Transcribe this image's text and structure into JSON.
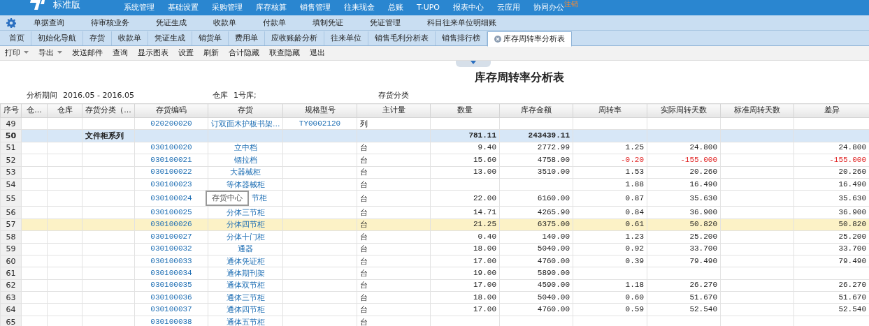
{
  "app": {
    "edition": "标准版",
    "menu": [
      "系统管理",
      "基础设置",
      "采购管理",
      "库存核算",
      "销售管理",
      "往来现金",
      "总账",
      "T-UPO",
      "报表中心",
      "云应用",
      "协同办公"
    ],
    "logout": "注销"
  },
  "quickbar": [
    "单据查询",
    "待审核业务",
    "凭证生成",
    "收款单",
    "付款单",
    "填制凭证",
    "凭证管理",
    "科目往来单位明细账"
  ],
  "tabs": [
    {
      "label": "首页",
      "selected": false
    },
    {
      "label": "初始化导航",
      "selected": false
    },
    {
      "label": "存货",
      "selected": false
    },
    {
      "label": "收款单",
      "selected": false
    },
    {
      "label": "凭证生成",
      "selected": false
    },
    {
      "label": "销货单",
      "selected": false
    },
    {
      "label": "费用单",
      "selected": false
    },
    {
      "label": "应收账龄分析",
      "selected": false
    },
    {
      "label": "往来单位",
      "selected": false
    },
    {
      "label": "销售毛利分析表",
      "selected": false
    },
    {
      "label": "销售排行榜",
      "selected": false
    },
    {
      "label": "库存周转率分析表",
      "selected": true
    }
  ],
  "toolbar": [
    {
      "label": "打印",
      "dropdown": true
    },
    {
      "label": "导出",
      "dropdown": true
    },
    {
      "label": "发送邮件",
      "dropdown": false
    },
    {
      "label": "查询",
      "dropdown": false
    },
    {
      "label": "显示图表",
      "dropdown": false
    },
    {
      "label": "设置",
      "dropdown": false
    },
    {
      "label": "刷新",
      "dropdown": false
    },
    {
      "label": "合计隐藏",
      "dropdown": false
    },
    {
      "label": "联查隐藏",
      "dropdown": false
    },
    {
      "label": "退出",
      "dropdown": false
    }
  ],
  "report": {
    "title": "库存周转率分析表",
    "filters": [
      {
        "label": "分析期间",
        "value": "2016.05 - 2016.05"
      },
      {
        "label": "仓库",
        "value": "1号库;"
      },
      {
        "label": "存货分类"
      }
    ]
  },
  "table": {
    "columns": [
      "序号",
      "仓...",
      "仓库",
      "存货分类（...",
      "存货编码",
      "存货",
      "规格型号",
      "主计量",
      "数量",
      "库存金额",
      "周转率",
      "实际周转天数",
      "标准周转天数",
      "差异"
    ],
    "rows": [
      {
        "kind": "item",
        "selected": false,
        "no": "49",
        "code": "020200020",
        "item": "订双面木护板书架...",
        "spec": "TY0002120",
        "unit": "列"
      },
      {
        "kind": "group",
        "selected": false,
        "no": "50",
        "category": "文件柜系列",
        "qty": "781.11",
        "amount": "243439.11"
      },
      {
        "kind": "item",
        "selected": false,
        "no": "51",
        "code": "030100020",
        "item": "立中档",
        "unit": "台",
        "qty": "9.40",
        "amount": "2772.99",
        "turnover": "1.25",
        "actual_days": "24.800",
        "diff": "24.800"
      },
      {
        "kind": "item",
        "selected": false,
        "negative": true,
        "no": "52",
        "code": "030100021",
        "item": "锢拉档",
        "unit": "台",
        "qty": "15.60",
        "amount": "4758.00",
        "turnover": "-0.20",
        "actual_days": "-155.000",
        "diff": "-155.000"
      },
      {
        "kind": "item",
        "selected": false,
        "no": "53",
        "code": "030100022",
        "item": "大器械柜",
        "unit": "台",
        "qty": "13.00",
        "amount": "3510.00",
        "turnover": "1.53",
        "actual_days": "20.260",
        "diff": "20.260"
      },
      {
        "kind": "item",
        "selected": false,
        "no": "54",
        "code": "030100023",
        "item": "等体器械柜",
        "unit": "台",
        "turnover": "1.88",
        "actual_days": "16.490",
        "diff": "16.490"
      },
      {
        "kind": "item",
        "selected": false,
        "no": "55",
        "code": "030100024",
        "item": "节柜",
        "unit": "台",
        "qty": "22.00",
        "amount": "6160.00",
        "turnover": "0.87",
        "actual_days": "35.630",
        "diff": "35.630",
        "tooltip": "存货中心"
      },
      {
        "kind": "item",
        "selected": false,
        "no": "56",
        "code": "030100025",
        "item": "分体三节柜",
        "unit": "台",
        "qty": "14.71",
        "amount": "4265.90",
        "turnover": "0.84",
        "actual_days": "36.900",
        "diff": "36.900"
      },
      {
        "kind": "item",
        "selected": true,
        "no": "57",
        "code": "030100026",
        "item": "分体四节柜",
        "unit": "台",
        "qty": "21.25",
        "amount": "6375.00",
        "turnover": "0.61",
        "actual_days": "50.820",
        "diff": "50.820"
      },
      {
        "kind": "item",
        "selected": false,
        "no": "58",
        "code": "030100027",
        "item": "分体十门柜",
        "unit": "台",
        "qty": "0.40",
        "amount": "140.00",
        "turnover": "1.23",
        "actual_days": "25.200",
        "diff": "25.200"
      },
      {
        "kind": "item",
        "selected": false,
        "no": "59",
        "code": "030100032",
        "item": "通器",
        "unit": "台",
        "qty": "18.00",
        "amount": "5040.00",
        "turnover": "0.92",
        "actual_days": "33.700",
        "diff": "33.700"
      },
      {
        "kind": "item",
        "selected": false,
        "no": "60",
        "code": "030100033",
        "item": "通体凭证柜",
        "unit": "台",
        "qty": "17.00",
        "amount": "4760.00",
        "turnover": "0.39",
        "actual_days": "79.490",
        "diff": "79.490"
      },
      {
        "kind": "item",
        "selected": false,
        "no": "61",
        "code": "030100034",
        "item": "通体期刊架",
        "unit": "台",
        "qty": "19.00",
        "amount": "5890.00"
      },
      {
        "kind": "item",
        "selected": false,
        "no": "62",
        "code": "030100035",
        "item": "通体双节柜",
        "unit": "台",
        "qty": "17.00",
        "amount": "4590.00",
        "turnover": "1.18",
        "actual_days": "26.270",
        "diff": "26.270"
      },
      {
        "kind": "item",
        "selected": false,
        "no": "63",
        "code": "030100036",
        "item": "通体三节柜",
        "unit": "台",
        "qty": "18.00",
        "amount": "5040.00",
        "turnover": "0.60",
        "actual_days": "51.670",
        "diff": "51.670"
      },
      {
        "kind": "item",
        "selected": false,
        "no": "64",
        "code": "030100037",
        "item": "通体四节柜",
        "unit": "台",
        "qty": "17.00",
        "amount": "4760.00",
        "turnover": "0.59",
        "actual_days": "52.540",
        "diff": "52.540"
      },
      {
        "kind": "item",
        "selected": false,
        "no": "65",
        "code": "030100038",
        "item": "通体五节柜",
        "unit": "台"
      }
    ]
  }
}
